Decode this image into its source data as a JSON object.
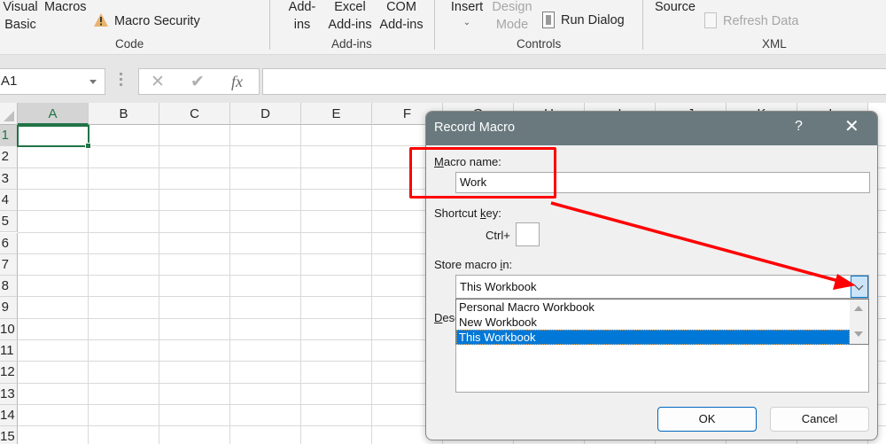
{
  "ribbon": {
    "groups": {
      "code": {
        "label": "Code",
        "visual_basic": [
          "Visual",
          "Basic"
        ],
        "macros": "Macros",
        "macro_security": "Macro Security"
      },
      "addins": {
        "label": "Add-ins",
        "addins": [
          "Add-",
          "ins"
        ],
        "excel_addins": [
          "Excel",
          "Add-ins"
        ],
        "com_addins": [
          "COM",
          "Add-ins"
        ]
      },
      "controls": {
        "label": "Controls",
        "insert": "Insert",
        "design_mode": [
          "Design",
          "Mode"
        ],
        "run_dialog": "Run Dialog"
      },
      "xml": {
        "label": "XML",
        "source": "Source",
        "refresh_data": "Refresh Data"
      }
    }
  },
  "formula_bar": {
    "name_box": "A1",
    "cancel_icon": "✕",
    "enter_icon": "✔",
    "fx": "fx",
    "formula": ""
  },
  "grid": {
    "columns": [
      "A",
      "B",
      "C",
      "D",
      "E",
      "F",
      "G",
      "H",
      "I",
      "J",
      "K",
      "L"
    ],
    "rows": [
      "1",
      "2",
      "3",
      "4",
      "5",
      "6",
      "7",
      "8",
      "9",
      "10",
      "11",
      "12",
      "13",
      "14",
      "15"
    ],
    "selected_cell": "A1"
  },
  "dialog": {
    "title": "Record Macro",
    "help": "?",
    "close": "✕",
    "macro_name_label": "Macro name:",
    "macro_name_accel": "M",
    "macro_name_rest": "acro name:",
    "macro_name_value": "Work",
    "shortcut_label_pre": "Shortcut ",
    "shortcut_label_accel": "k",
    "shortcut_label_post": "ey:",
    "ctrl_label": "Ctrl+",
    "shortcut_value": "",
    "store_label_pre": "Store macro ",
    "store_label_accel": "i",
    "store_label_post": "n:",
    "store_value": "This Workbook",
    "store_options": [
      "Personal Macro Workbook",
      "New Workbook",
      "This Workbook"
    ],
    "store_selected_index": 2,
    "description_label_accel": "D",
    "description_label_rest": "escription:",
    "description_value": "",
    "ok": "OK",
    "cancel": "Cancel"
  },
  "annotations": {
    "highlight_color": "#ff0000"
  }
}
